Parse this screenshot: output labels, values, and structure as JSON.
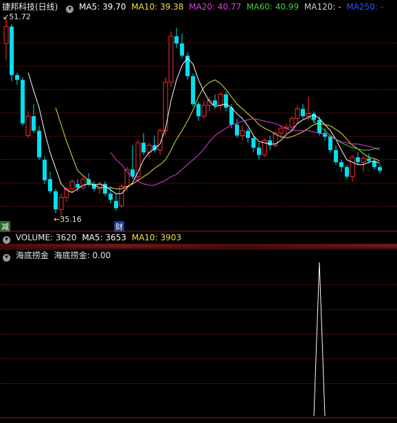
{
  "main_panel": {
    "title": "捷邦科技(日线)",
    "indicators": [
      {
        "label": "MA5: 39.70",
        "color": "#ffffff"
      },
      {
        "label": "MA10: 39.38",
        "color": "#f0e040"
      },
      {
        "label": "MA20: 40.77",
        "color": "#e040e0"
      },
      {
        "label": "MA60: 40.99",
        "color": "#40d040"
      },
      {
        "label": "MA120: -",
        "color": "#d0d0d0"
      },
      {
        "label": "MA250: -",
        "color": "#3050ff"
      }
    ],
    "high_label": "51.72",
    "low_label": "35.16",
    "tag_reduce": "减",
    "tag_finance": "财"
  },
  "volume_panel": {
    "title": "VOLUME: 3620",
    "ma5": "MA5: 3653",
    "ma10": "MA10: 3903"
  },
  "indicator_panel": {
    "name": "海底捞金",
    "value_label": "海底捞金: 0.00"
  },
  "colors": {
    "up": "#ff3030",
    "down": "#00e0f0",
    "grid": "#7a1515",
    "separator": "#8b1a1a",
    "ma5": "#ffffff",
    "ma10": "#f0e040",
    "ma20": "#e040e0",
    "ma60": "#40d040"
  },
  "chart_data": {
    "type": "candlestick",
    "y_high": 51.72,
    "y_low": 35.16,
    "candles": [
      [
        49.6,
        51.72,
        48.2,
        51.0
      ],
      [
        51.0,
        51.2,
        46.5,
        47.0
      ],
      [
        47.0,
        47.2,
        46.2,
        46.6
      ],
      [
        46.6,
        46.8,
        42.8,
        43.0
      ],
      [
        42.0,
        44.0,
        41.8,
        43.6
      ],
      [
        43.6,
        44.6,
        42.2,
        42.4
      ],
      [
        42.4,
        42.8,
        40.0,
        40.2
      ],
      [
        40.0,
        40.3,
        38.0,
        38.3
      ],
      [
        38.4,
        39.0,
        37.2,
        37.4
      ],
      [
        37.4,
        37.6,
        35.6,
        35.9
      ],
      [
        35.9,
        37.2,
        35.16,
        36.9
      ],
      [
        36.9,
        37.8,
        36.5,
        37.6
      ],
      [
        37.6,
        38.4,
        37.3,
        38.2
      ],
      [
        38.0,
        38.4,
        37.4,
        37.7
      ],
      [
        37.7,
        38.6,
        37.5,
        38.4
      ],
      [
        38.4,
        38.9,
        37.8,
        38.0
      ],
      [
        38.0,
        38.2,
        37.4,
        37.6
      ],
      [
        37.6,
        38.2,
        37.2,
        38.0
      ],
      [
        38.0,
        38.2,
        37.0,
        37.2
      ],
      [
        37.2,
        37.8,
        36.4,
        36.7
      ],
      [
        36.6,
        37.2,
        35.8,
        36.0
      ],
      [
        36.2,
        38.0,
        36.0,
        37.8
      ],
      [
        37.8,
        39.4,
        37.4,
        39.2
      ],
      [
        39.2,
        41.2,
        38.4,
        38.6
      ],
      [
        38.6,
        41.6,
        38.2,
        41.4
      ],
      [
        41.4,
        42.2,
        40.4,
        40.6
      ],
      [
        40.6,
        41.4,
        40.2,
        41.2
      ],
      [
        41.2,
        42.0,
        40.6,
        40.8
      ],
      [
        40.8,
        42.6,
        40.4,
        42.4
      ],
      [
        42.4,
        46.8,
        42.0,
        46.4
      ],
      [
        46.4,
        50.6,
        46.0,
        50.2
      ],
      [
        50.2,
        50.9,
        49.2,
        49.6
      ],
      [
        49.6,
        50.4,
        48.4,
        48.6
      ],
      [
        48.6,
        48.9,
        46.6,
        46.9
      ],
      [
        46.9,
        47.1,
        44.4,
        44.6
      ],
      [
        44.6,
        44.8,
        43.2,
        43.6
      ],
      [
        43.6,
        44.9,
        43.4,
        44.5
      ],
      [
        44.5,
        45.2,
        44.0,
        44.9
      ],
      [
        44.9,
        45.4,
        44.2,
        44.5
      ],
      [
        44.5,
        45.6,
        44.1,
        45.4
      ],
      [
        45.4,
        45.6,
        44.0,
        44.3
      ],
      [
        44.3,
        44.6,
        42.6,
        42.9
      ],
      [
        42.9,
        43.4,
        41.8,
        42.0
      ],
      [
        42.0,
        42.8,
        41.6,
        42.4
      ],
      [
        42.4,
        42.6,
        41.4,
        41.8
      ],
      [
        41.8,
        42.0,
        40.6,
        41.0
      ],
      [
        41.0,
        41.4,
        40.0,
        40.4
      ],
      [
        40.4,
        41.8,
        40.2,
        41.6
      ],
      [
        41.6,
        42.0,
        40.8,
        41.2
      ],
      [
        41.2,
        42.4,
        41.0,
        42.2
      ],
      [
        42.2,
        42.8,
        41.8,
        42.6
      ],
      [
        42.6,
        43.0,
        42.2,
        42.7
      ],
      [
        42.7,
        43.6,
        42.4,
        43.4
      ],
      [
        43.4,
        44.5,
        43.0,
        44.2
      ],
      [
        44.2,
        44.6,
        43.4,
        43.6
      ],
      [
        43.6,
        45.2,
        43.2,
        43.8
      ],
      [
        43.8,
        44.0,
        43.0,
        43.3
      ],
      [
        43.3,
        43.6,
        42.0,
        42.2
      ],
      [
        42.2,
        42.6,
        41.6,
        41.9
      ],
      [
        41.9,
        42.0,
        40.6,
        40.8
      ],
      [
        40.8,
        41.2,
        39.6,
        39.8
      ],
      [
        39.8,
        40.0,
        39.0,
        39.4
      ],
      [
        39.4,
        39.6,
        38.4,
        38.6
      ],
      [
        38.6,
        40.4,
        38.2,
        40.2
      ],
      [
        40.2,
        40.6,
        39.6,
        39.8
      ],
      [
        39.8,
        40.3,
        39.0,
        40.1
      ],
      [
        40.1,
        40.5,
        39.7,
        39.9
      ],
      [
        39.9,
        40.1,
        39.2,
        39.4
      ],
      [
        39.4,
        39.6,
        38.9,
        39.1
      ]
    ],
    "ma5": [
      null,
      null,
      null,
      null,
      47.2,
      45.7,
      44.3,
      42.3,
      40.6,
      39.3,
      38.0,
      37.5,
      37.3,
      37.6,
      37.9,
      38.0,
      37.9,
      38.0,
      37.8,
      37.5,
      37.2,
      37.2,
      37.7,
      38.1,
      39.0,
      40.0,
      40.6,
      40.9,
      41.3,
      42.6,
      44.9,
      46.6,
      47.8,
      48.4,
      47.9,
      46.6,
      45.6,
      44.8,
      44.4,
      44.5,
      44.6,
      44.3,
      43.8,
      43.4,
      42.8,
      42.0,
      41.5,
      41.4,
      41.3,
      41.3,
      41.6,
      42.1,
      42.4,
      43.0,
      43.3,
      43.5,
      43.7,
      43.4,
      42.9,
      42.4,
      41.7,
      40.8,
      40.0,
      39.8,
      39.6,
      39.6,
      39.8,
      39.9,
      39.7
    ],
    "ma10": [
      null,
      null,
      null,
      null,
      null,
      null,
      null,
      null,
      null,
      44.3,
      42.9,
      41.5,
      40.3,
      39.1,
      38.7,
      38.3,
      37.9,
      37.7,
      37.7,
      37.7,
      37.6,
      37.6,
      37.8,
      38.0,
      38.3,
      38.6,
      38.9,
      39.3,
      39.6,
      40.0,
      40.8,
      41.7,
      42.4,
      43.2,
      44.1,
      45.2,
      46.0,
      46.4,
      46.6,
      46.3,
      45.8,
      45.2,
      44.6,
      44.2,
      43.8,
      43.4,
      42.9,
      42.6,
      42.4,
      42.1,
      41.9,
      41.8,
      41.9,
      42.1,
      42.3,
      42.6,
      42.9,
      43.0,
      42.9,
      42.8,
      42.5,
      42.2,
      41.7,
      41.2,
      40.9,
      40.5,
      40.2,
      40.1,
      39.9
    ],
    "ma20": [
      null,
      null,
      null,
      null,
      null,
      null,
      null,
      null,
      null,
      null,
      null,
      null,
      null,
      null,
      null,
      null,
      null,
      null,
      null,
      40.6,
      40.0,
      39.6,
      39.0,
      38.6,
      38.2,
      38.0,
      37.9,
      37.9,
      38.1,
      38.3,
      38.6,
      38.8,
      39.2,
      39.6,
      40.0,
      40.4,
      40.9,
      41.5,
      42.0,
      42.3,
      42.6,
      42.9,
      43.0,
      43.2,
      43.3,
      43.4,
      43.3,
      43.2,
      43.1,
      43.0,
      42.8,
      42.6,
      42.4,
      42.4,
      42.4,
      42.4,
      42.3,
      42.2,
      42.1,
      41.9,
      41.7,
      41.5,
      41.4,
      41.3,
      41.3,
      41.2,
      41.1,
      41.0,
      40.8
    ],
    "ma60": [
      null,
      null,
      null,
      null,
      null,
      null,
      null,
      null,
      null,
      null,
      null,
      null,
      null,
      null,
      null,
      null,
      null,
      null,
      null,
      null,
      null,
      null,
      null,
      null,
      null,
      null,
      null,
      null,
      null,
      null,
      null,
      null,
      null,
      null,
      null,
      null,
      null,
      null,
      null,
      null,
      null,
      null,
      null,
      null,
      null,
      null,
      null,
      null,
      null,
      null,
      null,
      null,
      null,
      null,
      null,
      43.6,
      43.2,
      42.8,
      42.4,
      42.0,
      41.7,
      41.4,
      41.2,
      41.0,
      40.9,
      40.8,
      40.8,
      40.9,
      40.99
    ],
    "indicator_signal_index": 57
  }
}
